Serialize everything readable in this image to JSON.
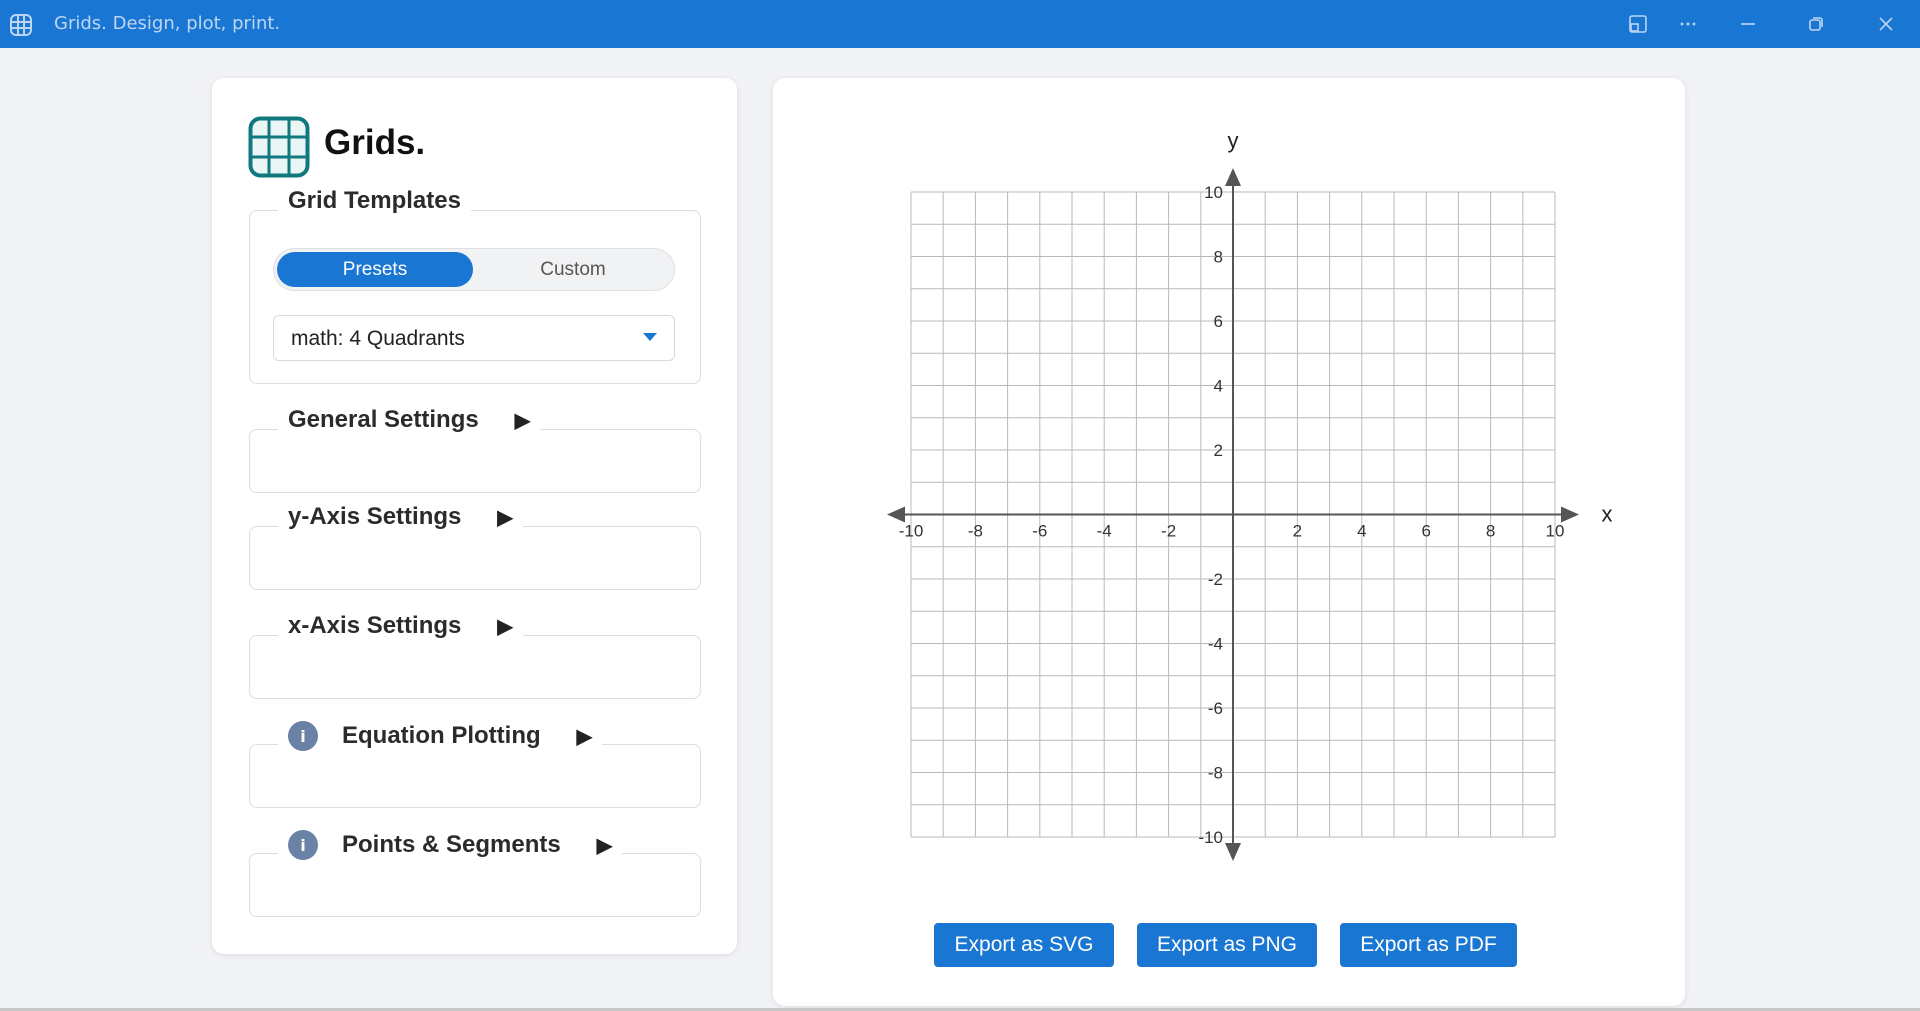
{
  "window": {
    "title": "Grids. Design, plot, print."
  },
  "app": {
    "logo_text": "Grids."
  },
  "templates": {
    "legend": "Grid Templates",
    "tabs": [
      "Presets",
      "Custom"
    ],
    "active_tab": "Presets",
    "selected_preset": "math: 4 Quadrants"
  },
  "sections": {
    "general": "General Settings",
    "y_axis": "y-Axis Settings",
    "x_axis": "x-Axis Settings",
    "equation": "Equation Plotting",
    "points": "Points & Segments",
    "info_glyph": "i",
    "expand_glyph": "▶"
  },
  "graph": {
    "x_label": "x",
    "y_label": "y",
    "x_range": [
      -10,
      10
    ],
    "y_range": [
      -10,
      10
    ],
    "minor_step": 1,
    "label_step": 2,
    "grid": true
  },
  "exports": {
    "svg": "Export as SVG",
    "png": "Export as PNG",
    "pdf": "Export as PDF"
  },
  "colors": {
    "accent": "#1976d2",
    "grid_line": "#b9b9b9",
    "axis": "#555555"
  }
}
